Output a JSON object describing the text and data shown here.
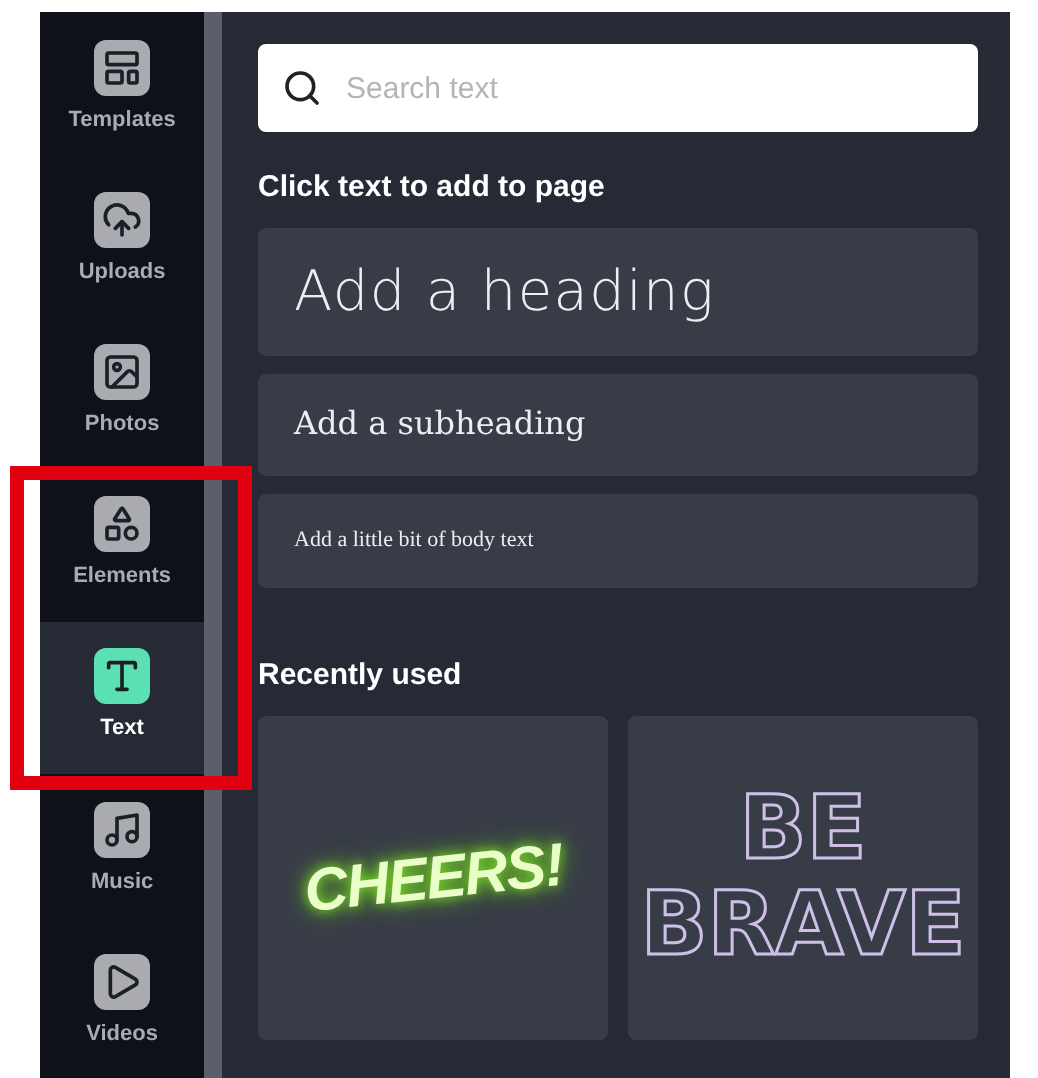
{
  "sidebar": {
    "items": [
      {
        "kind": "templates",
        "label": "Templates",
        "selected": false
      },
      {
        "kind": "uploads",
        "label": "Uploads",
        "selected": false
      },
      {
        "kind": "photos",
        "label": "Photos",
        "selected": false
      },
      {
        "kind": "elements",
        "label": "Elements",
        "selected": false
      },
      {
        "kind": "text",
        "label": "Text",
        "selected": true
      },
      {
        "kind": "music",
        "label": "Music",
        "selected": false
      },
      {
        "kind": "videos",
        "label": "Videos",
        "selected": false
      }
    ]
  },
  "highlight": {
    "on": true
  },
  "search": {
    "placeholder": "Search text"
  },
  "add_text": {
    "title": "Click text to add to page",
    "options": [
      {
        "kind": "heading",
        "label": "Add a heading"
      },
      {
        "kind": "subheading",
        "label": "Add a subheading"
      },
      {
        "kind": "body",
        "label": "Add a little bit of body text"
      }
    ]
  },
  "recently_used": {
    "title": "Recently used",
    "items": [
      {
        "kind": "neon",
        "lines": [
          "CHEERS!"
        ]
      },
      {
        "kind": "outline",
        "lines": [
          "BE",
          "BRAVE"
        ]
      }
    ]
  }
}
